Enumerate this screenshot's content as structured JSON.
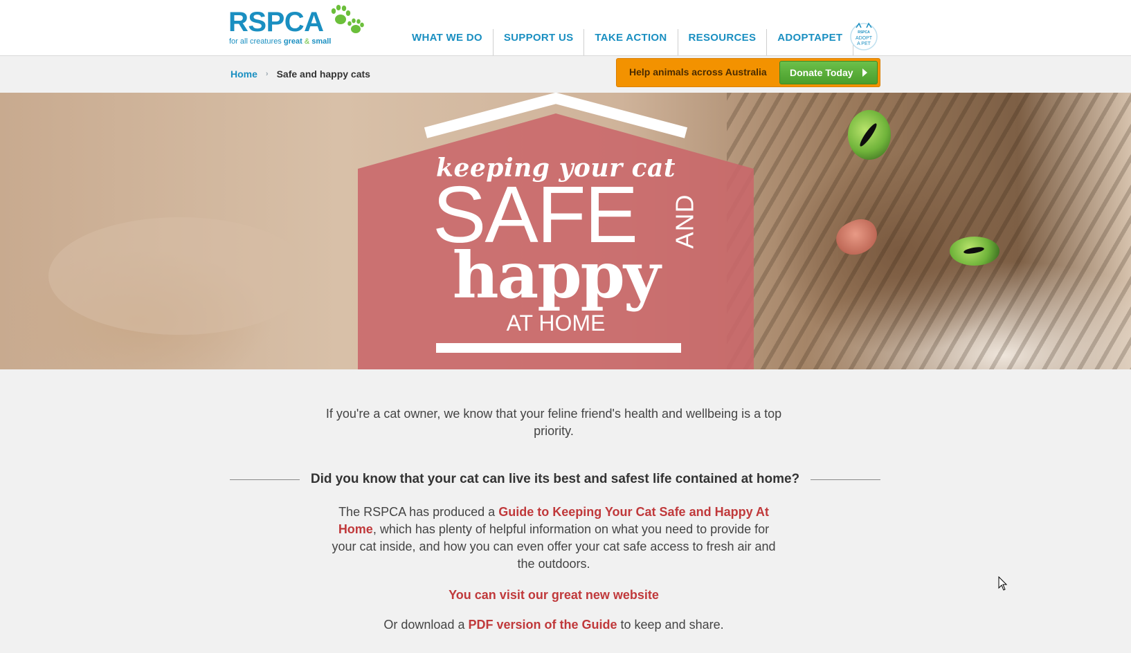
{
  "header": {
    "logo_text": "RSPCA",
    "logo_tag_prefix": "for all creatures ",
    "logo_tag_great": "great",
    "logo_tag_amp": " & ",
    "logo_tag_small": "small",
    "nav": [
      "WHAT WE DO",
      "SUPPORT US",
      "TAKE ACTION",
      "RESOURCES",
      "ADOPTAPET"
    ],
    "adopt_badge_text": "ADOPT A PET"
  },
  "breadcrumb": {
    "home": "Home",
    "separator": "›",
    "current": "Safe and happy cats"
  },
  "donate": {
    "prompt": "Help animals across Australia",
    "button": "Donate Today"
  },
  "hero": {
    "line1": "keeping your cat",
    "line2": "SAFE",
    "line3": "AND",
    "line4": "happy",
    "line5": "AT HOME"
  },
  "content": {
    "intro": "If you're a cat owner, we know that your feline friend's health and wellbeing is a top priority.",
    "question": "Did you know that your cat can live its best and safest life contained at home?",
    "guide_prefix": "The RSPCA has produced a ",
    "guide_link": "Guide to Keeping Your Cat Safe and Happy At Home",
    "guide_suffix": ", which has plenty of helpful information on what you need to provide for your cat inside, and how you can even offer your cat safe access to fresh air and the outdoors.",
    "visit_link": "You can visit our great new website",
    "download_prefix": "Or download a ",
    "download_link": "PDF version of the Guide",
    "download_suffix": " to keep and share."
  },
  "colors": {
    "brand_blue": "#1a8fc1",
    "paw_green": "#6bbf3a",
    "donate_orange": "#f39200",
    "donate_green": "#5bb03a",
    "link_red": "#c0393b",
    "hero_panel": "#c9676a"
  }
}
